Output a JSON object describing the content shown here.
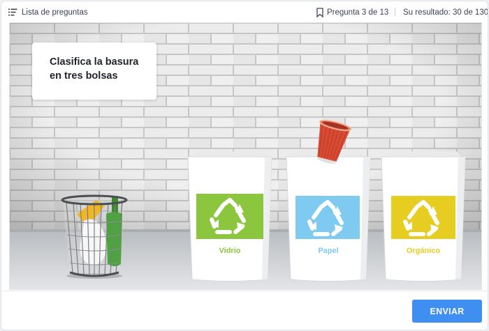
{
  "header": {
    "list_label": "Lista de preguntas",
    "question_label": "Pregunta 3 de 13",
    "score_label": "Su resultado: 30 de 130"
  },
  "task": {
    "prompt": "Clasifica la basura en tres bolsas"
  },
  "bins": [
    {
      "label": "Vidrio",
      "color": "#8cc63f"
    },
    {
      "label": "Papel",
      "color": "#7fcaf1"
    },
    {
      "label": "Orgánico",
      "color": "#e7cd21"
    }
  ],
  "icons": {
    "list": "list-icon",
    "bookmark": "bookmark-icon",
    "recycle": "recycle-icon"
  },
  "colors": {
    "accent": "#3f8ff2",
    "cup": "#d94a33"
  },
  "footer": {
    "submit_label": "ENVIAR"
  }
}
